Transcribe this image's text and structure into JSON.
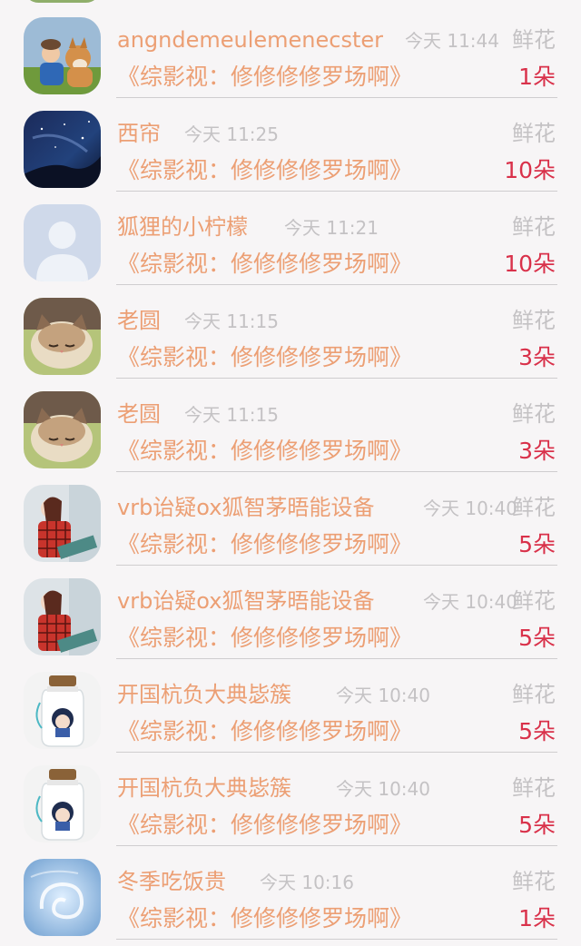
{
  "colors": {
    "accent": "#ec9f74",
    "count": "#d9314a",
    "muted": "#c4c2c4",
    "background": "#f7f5f6"
  },
  "rows": [
    {
      "name": "angndemeulemenecster",
      "time": "今天 11:44",
      "gift": "鲜花",
      "book": "《综影视：修修修修罗场啊》",
      "count": "1朵",
      "avatar": "dog-photo-icon"
    },
    {
      "name": "西帘",
      "time": "今天 11:25",
      "gift": "鲜花",
      "book": "《综影视：修修修修罗场啊》",
      "count": "10朵",
      "avatar": "night-sky-icon"
    },
    {
      "name": "狐狸的小柠檬",
      "time": "今天 11:21",
      "gift": "鲜花",
      "book": "《综影视：修修修修罗场啊》",
      "count": "10朵",
      "avatar": "default-person-icon"
    },
    {
      "name": "老圆",
      "time": "今天 11:15",
      "gift": "鲜花",
      "book": "《综影视：修修修修罗场啊》",
      "count": "3朵",
      "avatar": "sleeping-cat-icon"
    },
    {
      "name": "老圆",
      "time": "今天 11:15",
      "gift": "鲜花",
      "book": "《综影视：修修修修罗场啊》",
      "count": "3朵",
      "avatar": "sleeping-cat-icon"
    },
    {
      "name": "vrb诒疑ox狐智茅晤能设备",
      "time": "今天 10:40",
      "gift": "鲜花",
      "book": "《综影视：修修修修罗场啊》",
      "count": "5朵",
      "avatar": "girl-plaid-icon"
    },
    {
      "name": "vrb诒疑ox狐智茅晤能设备",
      "time": "今天 10:40",
      "gift": "鲜花",
      "book": "《综影视：修修修修罗场啊》",
      "count": "5朵",
      "avatar": "girl-plaid-icon"
    },
    {
      "name": "开国杭负大典毖簇",
      "time": "今天 10:40",
      "gift": "鲜花",
      "book": "《综影视：修修修修罗场啊》",
      "count": "5朵",
      "avatar": "jar-figure-icon"
    },
    {
      "name": "开国杭负大典毖簇",
      "time": "今天 10:40",
      "gift": "鲜花",
      "book": "《综影视：修修修修罗场啊》",
      "count": "5朵",
      "avatar": "jar-figure-icon"
    },
    {
      "name": "冬季吃饭贵",
      "time": "今天 10:16",
      "gift": "鲜花",
      "book": "《综影视：修修修修罗场啊》",
      "count": "1朵",
      "avatar": "ice-swirl-icon"
    }
  ]
}
